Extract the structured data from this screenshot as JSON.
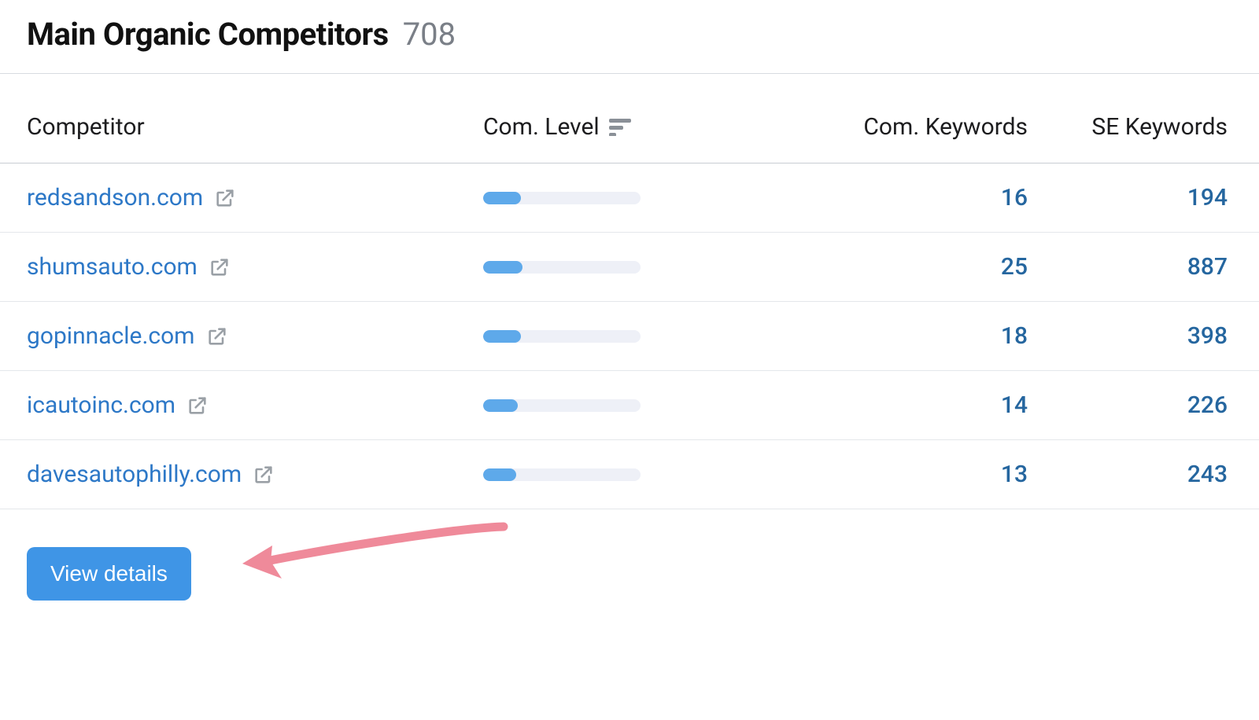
{
  "header": {
    "title": "Main Organic Competitors",
    "count": "708"
  },
  "columns": {
    "competitor": "Competitor",
    "level": "Com. Level",
    "keywords": "Com. Keywords",
    "se_keywords": "SE Keywords"
  },
  "rows": [
    {
      "domain": "redsandson.com",
      "level_pct": 24,
      "com_keywords": "16",
      "se_keywords": "194"
    },
    {
      "domain": "shumsauto.com",
      "level_pct": 25,
      "com_keywords": "25",
      "se_keywords": "887"
    },
    {
      "domain": "gopinnacle.com",
      "level_pct": 24,
      "com_keywords": "18",
      "se_keywords": "398"
    },
    {
      "domain": "icautoinc.com",
      "level_pct": 22,
      "com_keywords": "14",
      "se_keywords": "226"
    },
    {
      "domain": "davesautophilly.com",
      "level_pct": 21,
      "com_keywords": "13",
      "se_keywords": "243"
    }
  ],
  "footer": {
    "view_details": "View details"
  },
  "annotation": {
    "arrow_color": "#ef8a9a"
  }
}
